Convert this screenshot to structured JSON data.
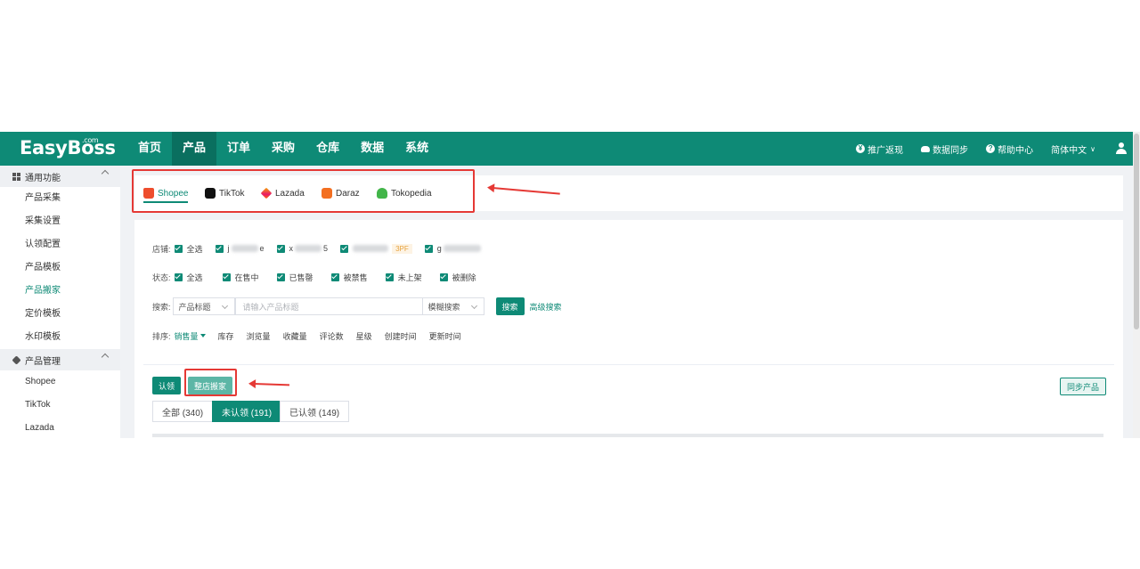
{
  "header": {
    "logo": "EasyBoss",
    "logo_suffix": ".com",
    "nav": [
      "首页",
      "产品",
      "订单",
      "采购",
      "仓库",
      "数据",
      "系统"
    ],
    "active_nav": "产品",
    "right": {
      "promo": "推广返现",
      "sync": "数据同步",
      "help": "帮助中心",
      "language": "简体中文"
    }
  },
  "sidebar": {
    "sections": [
      {
        "title": "通用功能",
        "items": [
          "产品采集",
          "采集设置",
          "认领配置",
          "产品模板",
          "产品搬家",
          "定价模板",
          "水印模板"
        ]
      },
      {
        "title": "产品管理",
        "items": [
          "Shopee",
          "TikTok",
          "Lazada"
        ]
      }
    ],
    "active_item": "产品搬家"
  },
  "platform_tabs": [
    "Shopee",
    "TikTok",
    "Lazada",
    "Daraz",
    "Tokopedia"
  ],
  "active_platform": "Shopee",
  "filters": {
    "store_label": "店铺:",
    "select_all": "全选",
    "stores": [
      "j",
      "e",
      "x",
      "5",
      "g"
    ],
    "store_tag": "3PF",
    "status_label": "状态:",
    "statuses": [
      "全选",
      "在售中",
      "已售罄",
      "被禁售",
      "未上架",
      "被删除"
    ],
    "search_label": "搜索:",
    "search_field": "产品标题",
    "search_placeholder": "请输入产品标题",
    "search_mode": "模糊搜索",
    "search_button": "搜索",
    "advanced_search": "高级搜索",
    "sort_label": "排序:",
    "sort_options": [
      "销售量",
      "库存",
      "浏览量",
      "收藏量",
      "评论数",
      "星级",
      "创建时间",
      "更新时间"
    ],
    "active_sort": "销售量"
  },
  "actions": {
    "claim": "认领",
    "move_store": "整店搬家",
    "sync_products": "同步产品"
  },
  "status_tabs": [
    "全部 (340)",
    "未认领 (191)",
    "已认领 (149)"
  ],
  "active_status_tab": "未认领 (191)",
  "colors": {
    "brand": "#0e8a76",
    "annotation": "#e53935"
  }
}
